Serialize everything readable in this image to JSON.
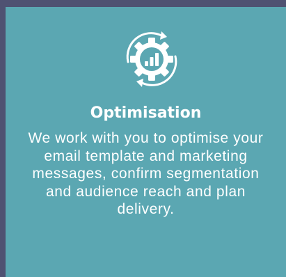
{
  "card": {
    "icon": "gear-chart-cycle-icon",
    "title": "Optimisation",
    "description": "We work with you to optimise your email template and marketing messages, confirm segmentation and audience reach and plan delivery."
  },
  "colors": {
    "background": "#4f5272",
    "card": "#5ba7b2",
    "text": "#ffffff"
  }
}
